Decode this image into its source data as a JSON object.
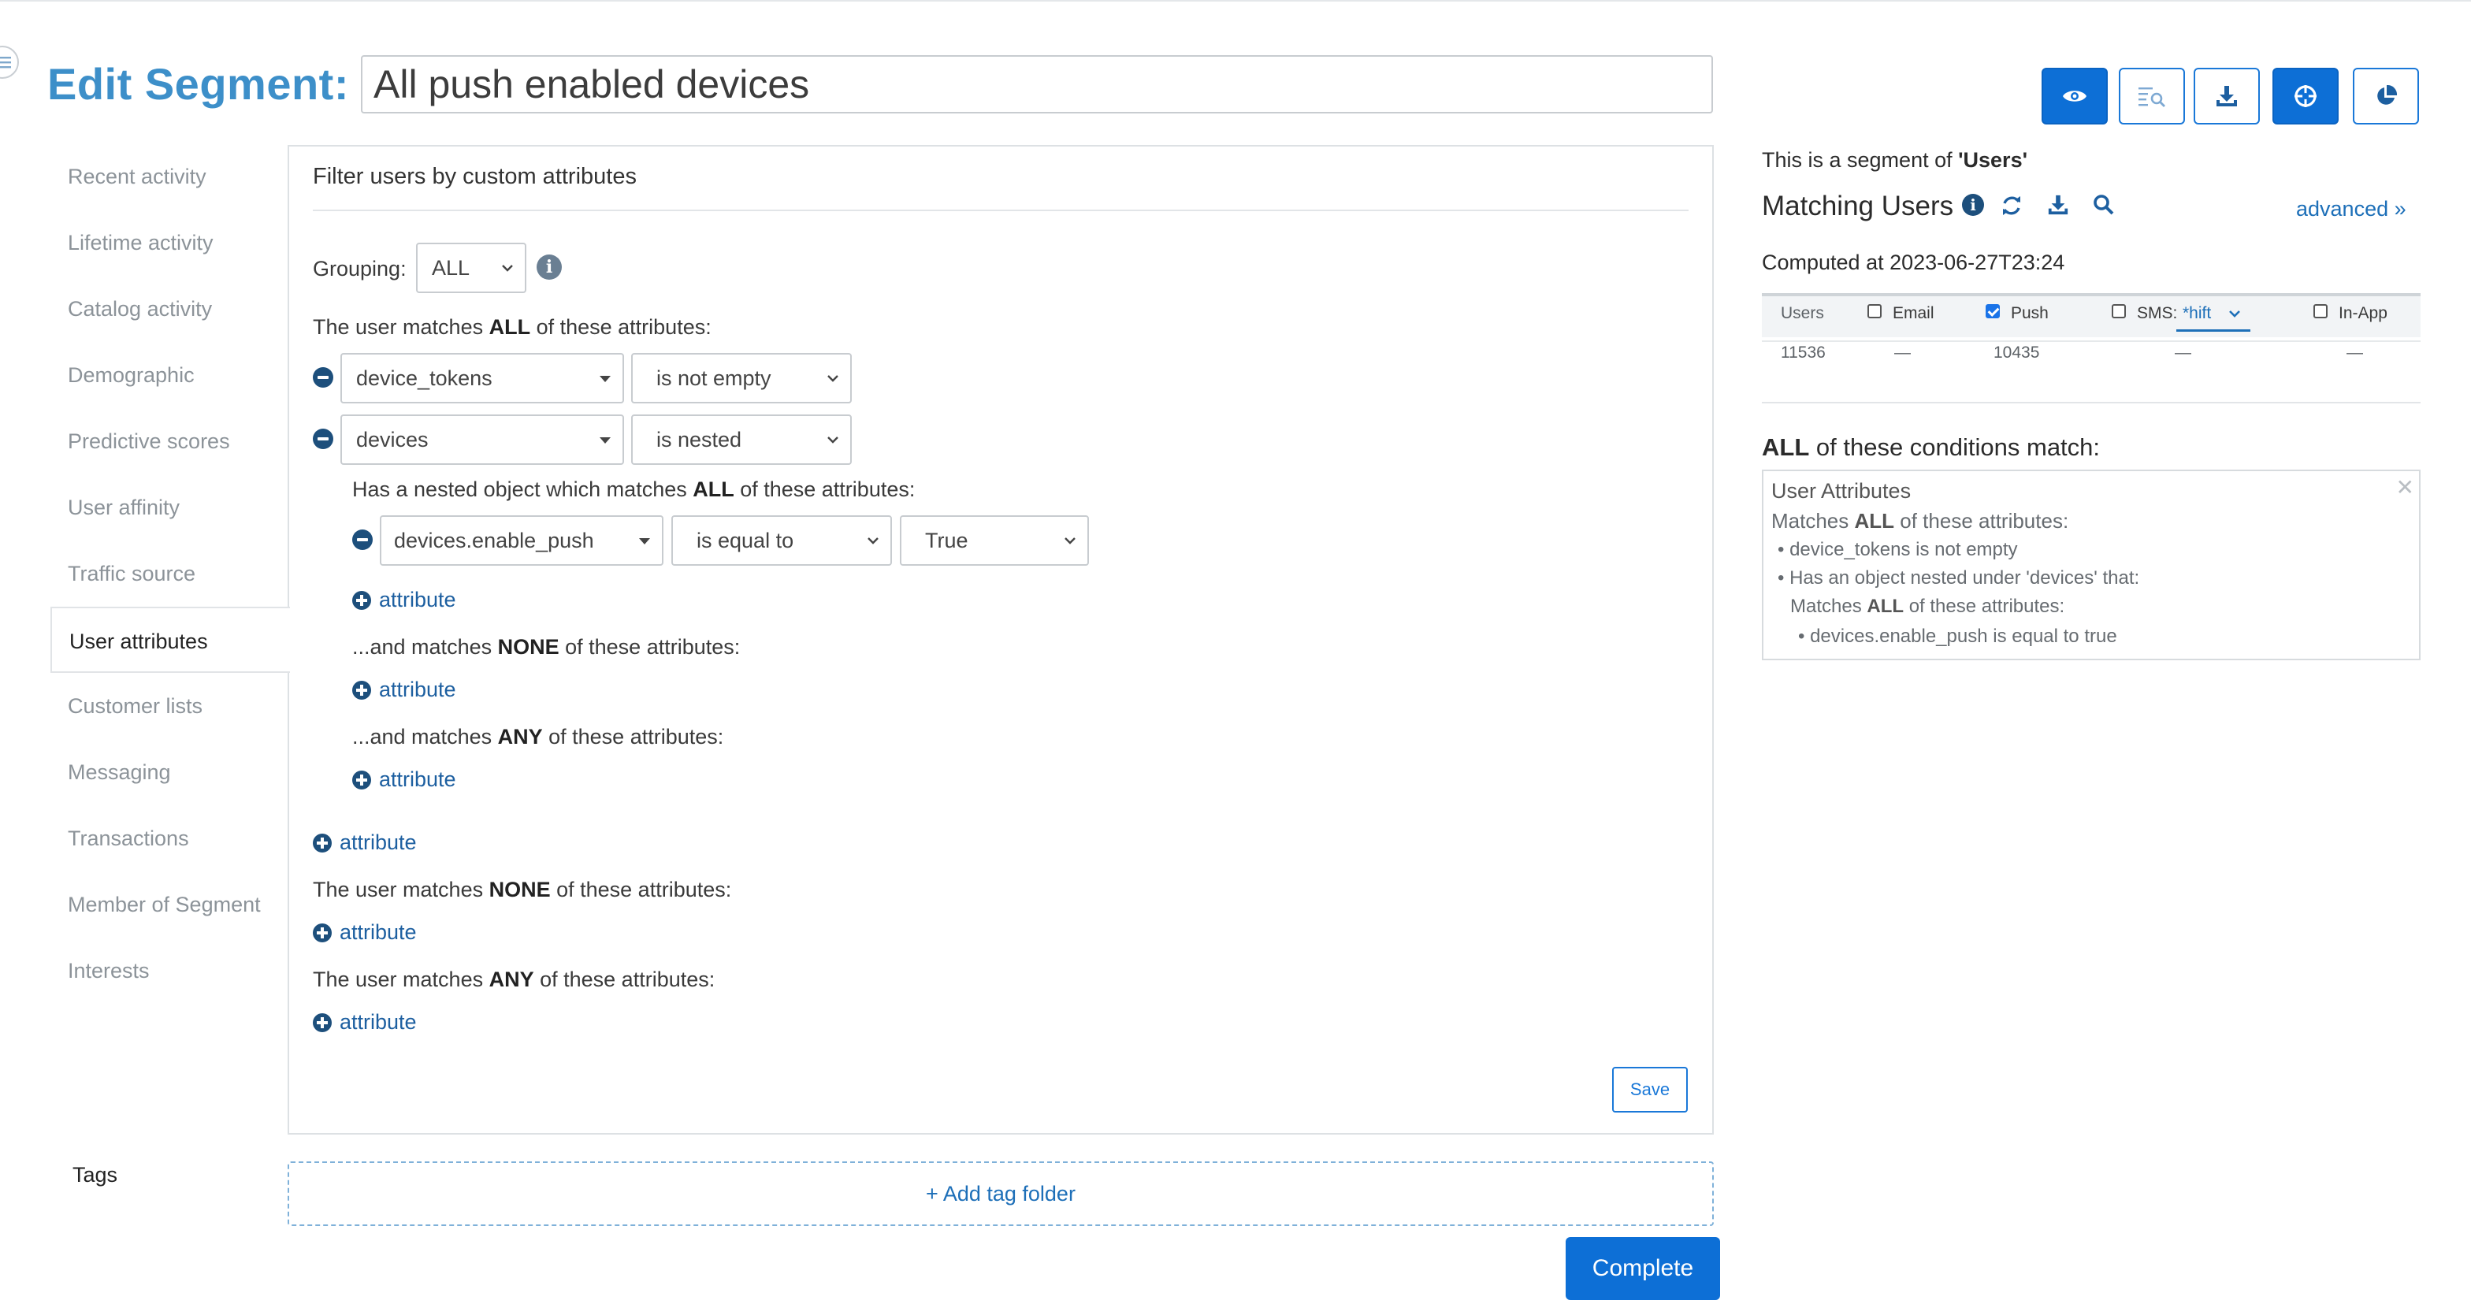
{
  "header": {
    "title_label": "Edit Segment:",
    "segment_name": "All push enabled devices"
  },
  "toolbar": {
    "buttons": [
      {
        "icon": "eye-icon",
        "style": "solid"
      },
      {
        "icon": "search-list-icon",
        "style": "outline"
      },
      {
        "icon": "download-icon",
        "style": "outline"
      },
      {
        "icon": "crosshair-icon",
        "style": "solid"
      },
      {
        "icon": "pie-chart-icon",
        "style": "outline"
      }
    ]
  },
  "sidebar": {
    "items": [
      {
        "label": "Recent activity"
      },
      {
        "label": "Lifetime activity"
      },
      {
        "label": "Catalog activity"
      },
      {
        "label": "Demographic"
      },
      {
        "label": "Predictive scores"
      },
      {
        "label": "User affinity"
      },
      {
        "label": "Traffic source"
      },
      {
        "label": "User attributes",
        "active": true
      },
      {
        "label": "Customer lists"
      },
      {
        "label": "Messaging"
      },
      {
        "label": "Transactions"
      },
      {
        "label": "Member of Segment"
      },
      {
        "label": "Interests"
      }
    ]
  },
  "filter": {
    "title": "Filter users by custom attributes",
    "grouping_label": "Grouping:",
    "grouping_value": "ALL",
    "all_prefix": "The user matches ",
    "all_keyword": "ALL",
    "all_suffix": " of these attributes:",
    "rows": [
      {
        "attribute": "device_tokens",
        "operator": "is not empty"
      },
      {
        "attribute": "devices",
        "operator": "is nested"
      }
    ],
    "nested": {
      "intro_prefix": "Has a nested object which matches ",
      "intro_keyword": "ALL",
      "intro_suffix": " of these attributes:",
      "row": {
        "attribute": "devices.enable_push",
        "operator": "is equal to",
        "value": "True"
      },
      "none_prefix": "...and matches ",
      "none_keyword": "NONE",
      "none_suffix": " of these attributes:",
      "any_prefix": "...and matches ",
      "any_keyword": "ANY",
      "any_suffix": " of these attributes:"
    },
    "add_label": "attribute",
    "none_prefix": "The user matches ",
    "none_keyword": "NONE",
    "none_suffix": " of these attributes:",
    "any_prefix": "The user matches ",
    "any_keyword": "ANY",
    "any_suffix": " of these attributes:",
    "save_label": "Save"
  },
  "tags": {
    "label": "Tags",
    "add_folder": "+ Add tag folder"
  },
  "complete_label": "Complete",
  "right_panel": {
    "segment_of_prefix": "This is a segment of ",
    "segment_of_name": "'Users'",
    "matching_title": "Matching Users",
    "advanced": "advanced »",
    "computed": "Computed at 2023-06-27T23:24",
    "table": {
      "headers": {
        "users": "Users",
        "email": "Email",
        "push": "Push",
        "sms": "SMS:",
        "shift": "*hift",
        "inapp": "In-App"
      },
      "checked": {
        "email": false,
        "push": true,
        "sms": false,
        "inapp": false
      },
      "row": {
        "users": "11536",
        "email": "—",
        "push": "10435",
        "sms": "—",
        "inapp": "—"
      }
    },
    "conditions_keyword": "ALL",
    "conditions_suffix": " of these conditions match:",
    "summary": {
      "heading": "User Attributes",
      "line1_prefix": "Matches ",
      "line1_keyword": "ALL",
      "line1_suffix": " of these attributes:",
      "line2": "• device_tokens is not empty",
      "line3": "• Has an object nested under 'devices' that:",
      "line4_prefix": "Matches ",
      "line4_keyword": "ALL",
      "line4_suffix": " of these attributes:",
      "line5": "• devices.enable_push is equal to true"
    }
  },
  "colors": {
    "brand_blue": "#0d6fd6",
    "title_blue": "#3d8fc9",
    "link_blue": "#1d6fb8",
    "icon_navy": "#1d4f7c"
  }
}
